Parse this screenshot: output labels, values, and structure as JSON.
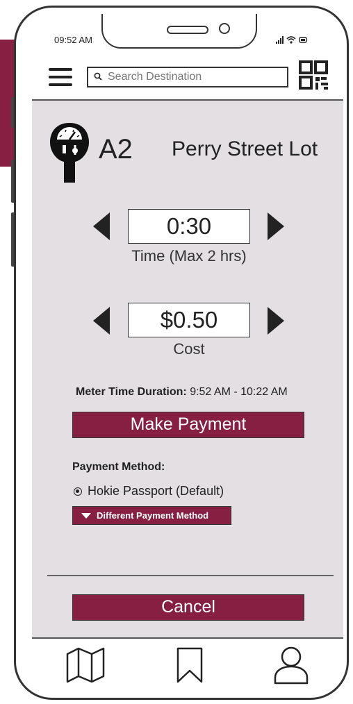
{
  "colors": {
    "accent": "#861f41",
    "screen_bg": "#e4dfe3"
  },
  "status_bar": {
    "time": "09:52 AM",
    "icons": "signal wifi battery"
  },
  "header": {
    "menu_icon": "hamburger-menu-icon",
    "search": {
      "placeholder": "Search Destination",
      "icon": "search-icon"
    },
    "qr_icon": "qr-code-icon"
  },
  "lot": {
    "icon": "parking-meter-icon",
    "code": "A2",
    "name": "Perry Street Lot"
  },
  "time_selector": {
    "value": "0:30",
    "caption": "Time (Max 2 hrs)"
  },
  "cost_selector": {
    "value": "$0.50",
    "caption": "Cost"
  },
  "duration": {
    "label": "Meter Time Duration:",
    "value": "9:52 AM - 10:22 AM"
  },
  "actions": {
    "make_payment": "Make Payment",
    "cancel": "Cancel"
  },
  "payment_method": {
    "label": "Payment Method:",
    "selected": "Hokie Passport (Default)",
    "different_button": "Different Payment Method"
  },
  "tab_bar": {
    "items": [
      "map-icon",
      "bookmark-icon",
      "profile-icon"
    ]
  }
}
